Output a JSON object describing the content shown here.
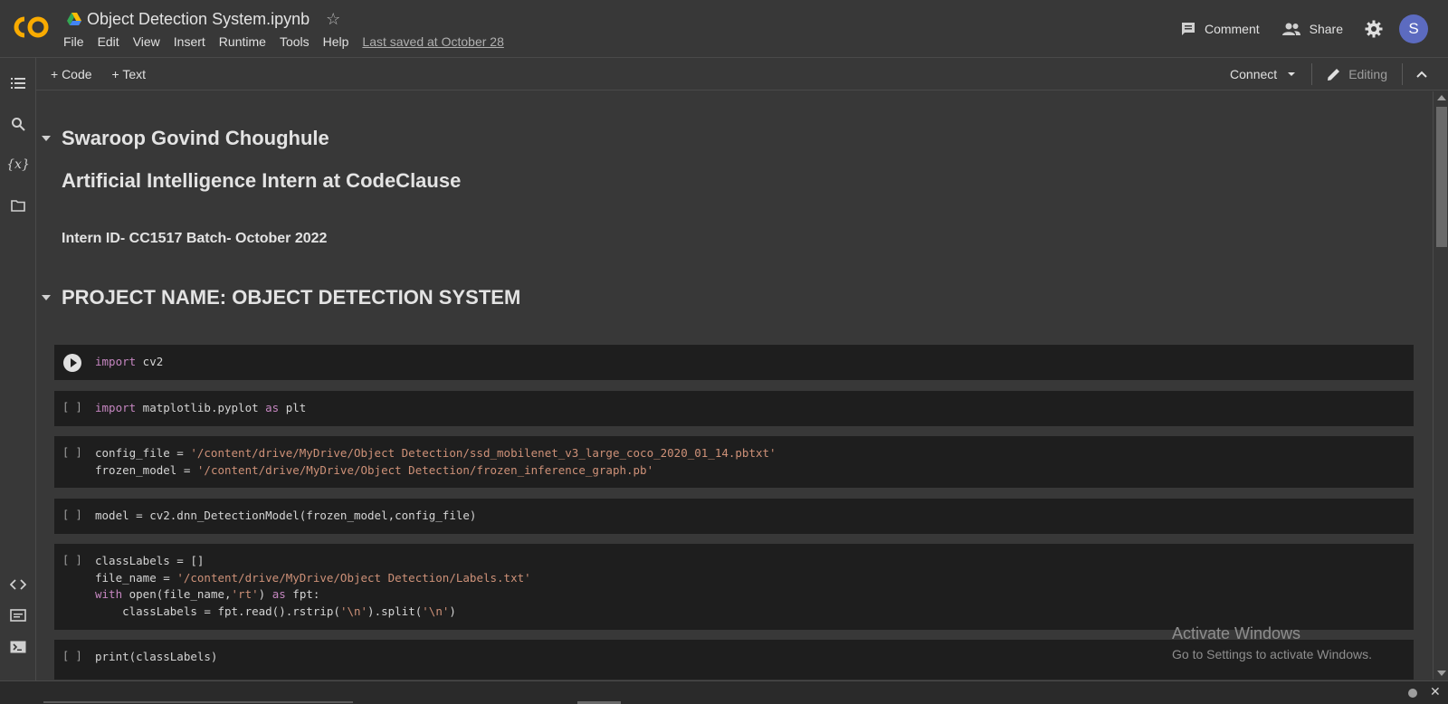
{
  "header": {
    "title": "Object Detection System.ipynb",
    "menu": [
      "File",
      "Edit",
      "View",
      "Insert",
      "Runtime",
      "Tools",
      "Help"
    ],
    "last_saved": "Last saved at October 28",
    "comment_label": "Comment",
    "share_label": "Share",
    "avatar_initial": "S"
  },
  "toolbar": {
    "add_code": "+ Code",
    "add_text": "+ Text",
    "connect": "Connect",
    "editing": "Editing"
  },
  "sidebar": {
    "icons": [
      "table-of-contents-icon",
      "search-icon",
      "variables-icon",
      "files-icon",
      "code-snippets-icon",
      "command-palette-icon",
      "terminal-icon"
    ]
  },
  "notebook": {
    "heading_name": "Swaroop Govind Choughule",
    "heading_role": "Artificial Intelligence Intern at CodeClause",
    "intern_id": "Intern ID- CC1517 Batch- October 2022",
    "project_heading": "PROJECT NAME: OBJECT DETECTION SYSTEM",
    "empty_gutter": "[ ]",
    "cells": [
      {
        "lines": [
          [
            {
              "t": "import",
              "c": "kw"
            },
            {
              "t": " cv2",
              "c": ""
            }
          ]
        ]
      },
      {
        "lines": [
          [
            {
              "t": "import",
              "c": "kw"
            },
            {
              "t": " matplotlib.pyplot ",
              "c": ""
            },
            {
              "t": "as",
              "c": "kw"
            },
            {
              "t": " plt",
              "c": ""
            }
          ]
        ]
      },
      {
        "lines": [
          [
            {
              "t": "config_file = ",
              "c": ""
            },
            {
              "t": "'/content/drive/MyDrive/Object Detection/ssd_mobilenet_v3_large_coco_2020_01_14.pbtxt'",
              "c": "str"
            }
          ],
          [
            {
              "t": "frozen_model = ",
              "c": ""
            },
            {
              "t": "'/content/drive/MyDrive/Object Detection/frozen_inference_graph.pb'",
              "c": "str"
            }
          ]
        ]
      },
      {
        "lines": [
          [
            {
              "t": "model = cv2.dnn_DetectionModel(frozen_model,config_file)",
              "c": ""
            }
          ]
        ]
      },
      {
        "lines": [
          [
            {
              "t": "classLabels = []",
              "c": ""
            }
          ],
          [
            {
              "t": "file_name = ",
              "c": ""
            },
            {
              "t": "'/content/drive/MyDrive/Object Detection/Labels.txt'",
              "c": "str"
            }
          ],
          [
            {
              "t": "with",
              "c": "kw"
            },
            {
              "t": " open(file_name,",
              "c": ""
            },
            {
              "t": "'rt'",
              "c": "str"
            },
            {
              "t": ") ",
              "c": ""
            },
            {
              "t": "as",
              "c": "kw"
            },
            {
              "t": " fpt:",
              "c": ""
            }
          ],
          [
            {
              "t": "    classLabels = fpt.read().rstrip(",
              "c": ""
            },
            {
              "t": "'\\n'",
              "c": "str"
            },
            {
              "t": ").split(",
              "c": ""
            },
            {
              "t": "'\\n'",
              "c": "str"
            },
            {
              "t": ")",
              "c": ""
            }
          ]
        ]
      },
      {
        "lines": [
          [
            {
              "t": "print(classLabels)",
              "c": ""
            }
          ]
        ]
      }
    ]
  },
  "watermark": {
    "line1": "Activate Windows",
    "line2": "Go to Settings to activate Windows."
  }
}
